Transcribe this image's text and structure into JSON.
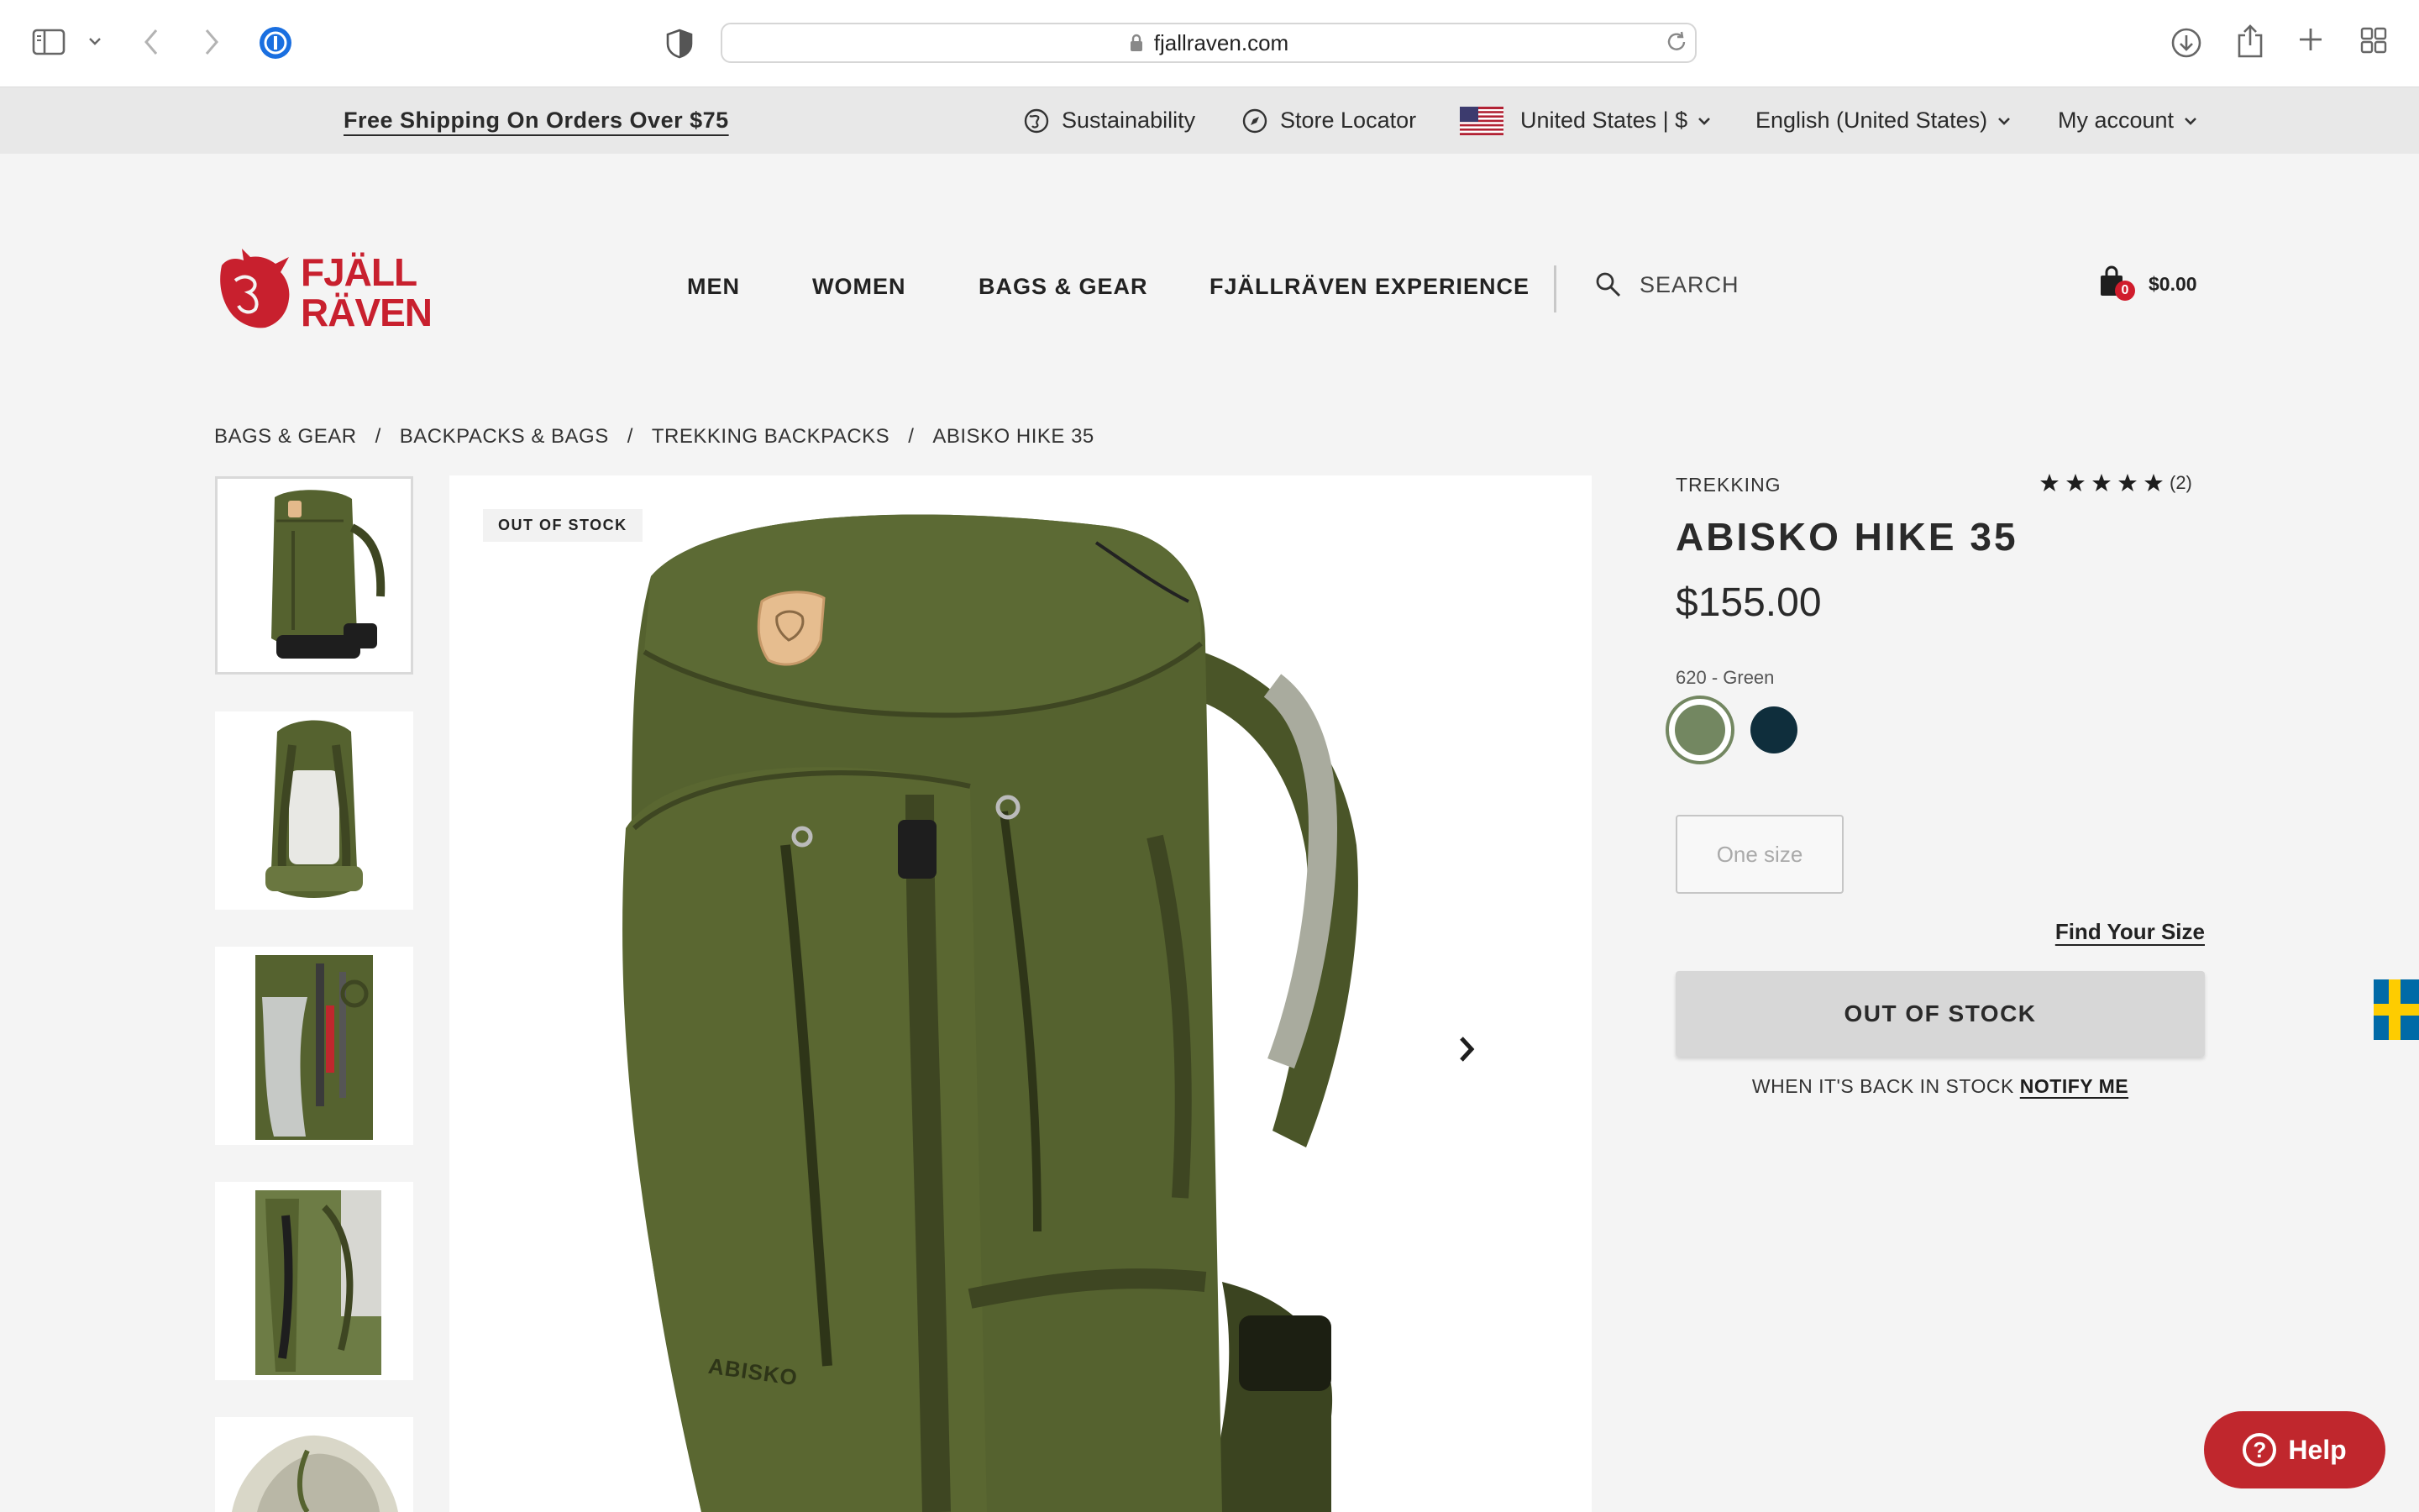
{
  "browser": {
    "url": "fjallraven.com"
  },
  "utility_bar": {
    "free_shipping": "Free Shipping On Orders Over $75",
    "sustainability": "Sustainability",
    "store_locator": "Store Locator",
    "region": "United States | $",
    "language": "English (United States)",
    "account": "My account"
  },
  "header": {
    "brand": "FJÄLLRÄVEN",
    "nav": [
      "MEN",
      "WOMEN",
      "BAGS & GEAR",
      "FJÄLLRÄVEN EXPERIENCE"
    ],
    "search_label": "SEARCH",
    "cart_count": "0",
    "cart_total": "$0.00"
  },
  "breadcrumb": [
    "BAGS & GEAR",
    "BACKPACKS & BAGS",
    "TREKKING BACKPACKS",
    "ABISKO HIKE 35"
  ],
  "gallery": {
    "badge": "OUT OF STOCK",
    "product_print": "ABISKO"
  },
  "product": {
    "category": "TREKKING",
    "rating": 5,
    "review_count": "(2)",
    "title": "ABISKO HIKE 35",
    "price": "$155.00",
    "color_label": "620 - Green",
    "colors": [
      "#738761",
      "#0f2e3c"
    ],
    "size": "One size",
    "find_size": "Find Your Size",
    "stock_button": "OUT OF STOCK",
    "notify_text": "WHEN IT'S BACK IN STOCK ",
    "notify_link": "NOTIFY ME"
  },
  "help": {
    "label": "Help"
  },
  "colors": {
    "brand_red": "#c8202e",
    "pack_green": "#55622f"
  }
}
